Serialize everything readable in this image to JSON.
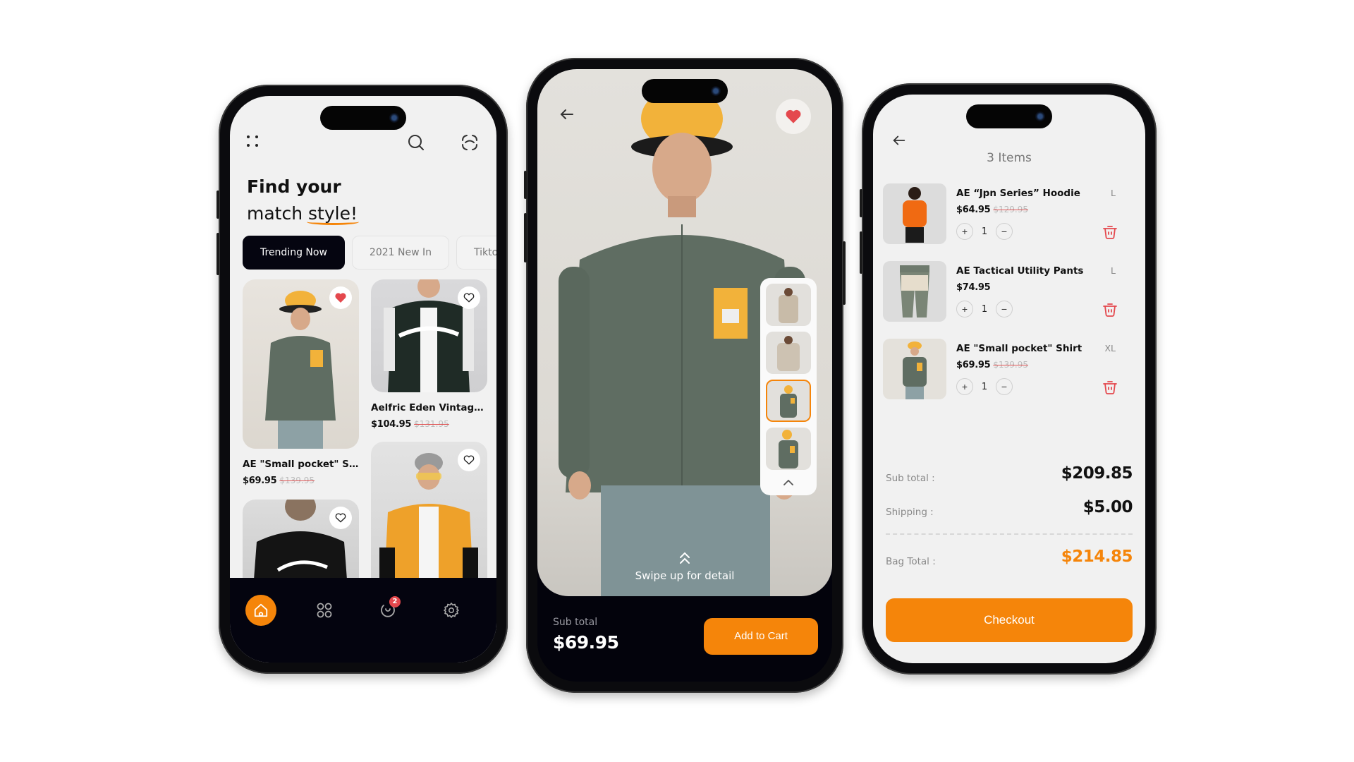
{
  "home": {
    "headline_line1": "Find your",
    "headline_line2_prefix": "match ",
    "headline_line2_emphasis": "style!",
    "chips": [
      {
        "label": "Trending Now",
        "active": true
      },
      {
        "label": "2021 New In",
        "active": false
      },
      {
        "label": "Tiktok",
        "active": false
      }
    ],
    "products": [
      {
        "name": "AE \"Small pocket\" Shirt",
        "price": "$69.95",
        "old_price": "$139.95",
        "favorited": true
      },
      {
        "name": "Aelfric Eden Vintage ...",
        "price": "$104.95",
        "old_price": "$131.95",
        "favorited": false
      },
      {
        "name": "",
        "price": "",
        "old_price": "",
        "favorited": false
      },
      {
        "name": "",
        "price": "",
        "old_price": "",
        "favorited": false
      }
    ],
    "tabbar": {
      "items": [
        "home-icon",
        "grid-icon",
        "orders-icon",
        "settings-icon"
      ],
      "active": "home-icon",
      "badge_count": "2"
    }
  },
  "detail": {
    "favorited": true,
    "swipe_hint": "Swipe up for detail",
    "subtotal_label": "Sub total",
    "subtotal_value": "$69.95",
    "add_to_cart_label": "Add to Cart",
    "thumbnails_count": 4,
    "selected_thumbnail": 3
  },
  "cart": {
    "title": "3 Items",
    "items": [
      {
        "name": "AE “Jpn Series” Hoodie",
        "price": "$64.95",
        "old_price": "$129.95",
        "size": "L",
        "qty": "1"
      },
      {
        "name": "AE Tactical Utility Pants",
        "price": "$74.95",
        "old_price": "",
        "size": "L",
        "qty": "1"
      },
      {
        "name": "AE \"Small pocket\" Shirt",
        "price": "$69.95",
        "old_price": "$139.95",
        "size": "XL",
        "qty": "1"
      }
    ],
    "summary": {
      "subtotal_label": "Sub total :",
      "subtotal_value": "$209.85",
      "shipping_label": "Shipping :",
      "shipping_value": "$5.00",
      "bag_total_label": "Bag Total :",
      "bag_total_value": "$214.85"
    },
    "checkout_label": "Checkout"
  },
  "colors": {
    "accent": "#f5850a",
    "dark": "#04040f",
    "favorite": "#e4484d",
    "screen_bg": "#f1f1f1"
  }
}
